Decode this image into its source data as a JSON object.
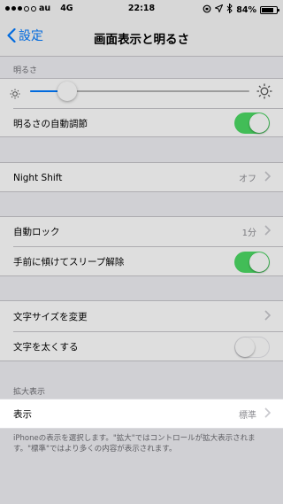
{
  "status": {
    "carrier": "au",
    "network": "4G",
    "time": "22:18",
    "battery": "84%",
    "battery_level": 0.84
  },
  "nav": {
    "back_label": "設定",
    "title": "画面表示と明るさ"
  },
  "brightness": {
    "header": "明るさ",
    "level": 0.17,
    "auto_label": "明るさの自動調節",
    "auto_on": true
  },
  "night_shift": {
    "label": "Night Shift",
    "value": "オフ"
  },
  "lock": {
    "auto_lock_label": "自動ロック",
    "auto_lock_value": "1分",
    "raise_to_wake_label": "手前に傾けてスリープ解除",
    "raise_to_wake_on": true
  },
  "text": {
    "text_size_label": "文字サイズを変更",
    "bold_text_label": "文字を太くする",
    "bold_on": false
  },
  "zoom": {
    "header": "拡大表示",
    "view_label": "表示",
    "view_value": "標準",
    "footer": "iPhoneの表示を選択します。\"拡大\"ではコントロールが拡大表示されます。\"標準\"ではより多くの内容が表示されます。"
  },
  "colors": {
    "accent": "#007aff",
    "toggle_on": "#4cd964"
  }
}
